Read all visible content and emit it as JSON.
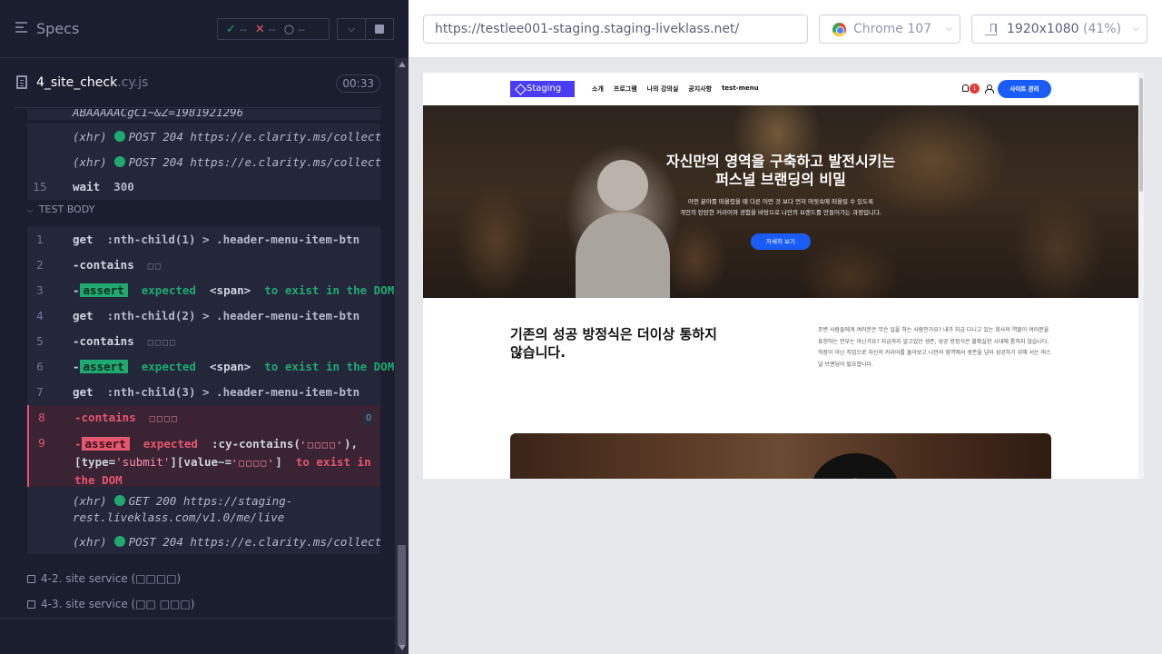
{
  "reporter": {
    "specs_label": "Specs",
    "stats": {
      "passed": "--",
      "failed": "--",
      "pending": "--"
    },
    "spec_file": {
      "name": "4_site_check",
      "ext": ".cy.js",
      "duration": "00:33"
    },
    "truncated_line": "ABAAAAACgC1~&Z=1981921296",
    "before_cmds": [
      {
        "num": "",
        "type": "(xhr)",
        "text": "POST 204 https://e.clarity.ms/collect"
      },
      {
        "num": "",
        "type": "(xhr)",
        "text": "POST 204 https://e.clarity.ms/collect"
      },
      {
        "num": "15",
        "name": "wait",
        "arg": "300"
      }
    ],
    "section_label": "TEST BODY",
    "commands": [
      {
        "num": "1",
        "name": "get",
        "arg": ":nth-child(1) > .header-menu-item-btn"
      },
      {
        "num": "2",
        "name": "-contains",
        "arg": "□□"
      },
      {
        "num": "3",
        "name": "-",
        "badge": "assert",
        "pre": "expected",
        "tag": "<span>",
        "post": "to exist in the DOM"
      },
      {
        "num": "4",
        "name": "get",
        "arg": ":nth-child(2) > .header-menu-item-btn"
      },
      {
        "num": "5",
        "name": "-contains",
        "arg": "□□□□"
      },
      {
        "num": "6",
        "name": "-",
        "badge": "assert",
        "pre": "expected",
        "tag": "<span>",
        "post": "to exist in the DOM"
      },
      {
        "num": "7",
        "name": "get",
        "arg": ":nth-child(3) > .header-menu-item-btn"
      },
      {
        "num": "8",
        "name": "-contains",
        "arg": "□□□□",
        "count": "0"
      },
      {
        "num": "9",
        "name": "-",
        "badge": "assert",
        "pre": "expected",
        "sel_open": ":cy-contains(",
        "q1": "'□□□□'",
        "sel_close": "),",
        "line2a": "[type=",
        "q2": "'submit'",
        "line2b": "][value~=",
        "q3": "'□□□□'",
        "line2c": "]",
        "post": "to exist in",
        "post2": "the DOM"
      }
    ],
    "after_cmds": [
      {
        "type": "(xhr)",
        "text": "GET 200 https://staging-",
        "text2": "rest.liveklass.com/v1.0/me/live"
      },
      {
        "type": "(xhr)",
        "text": "POST 204 https://e.clarity.ms/collect"
      }
    ],
    "suites": [
      {
        "label": "4-2. site service (□□□□)"
      },
      {
        "label": "4-3. site service (□□ □□□)"
      }
    ]
  },
  "aut": {
    "url": "https://testlee001-staging.staging-liveklass.net/",
    "browser": "Chrome 107",
    "viewport": "1920x1080",
    "scale": "(41%)",
    "site": {
      "logo": "Staging",
      "nav": [
        "소개",
        "프로그램",
        "나의 강의실",
        "공지사항",
        "test-menu"
      ],
      "notif_count": "1",
      "admin_button": "사이트 관리",
      "hero_title_1": "자신만의 영역을 구축하고 발전시키는",
      "hero_title_2": "퍼스널 브랜딩의 비밀",
      "hero_sub_1": "어떤 분야를 떠올렸을 때 다른 어떤 것 보다 먼저 머릿속에 떠올릴 수 있도록",
      "hero_sub_2": "개인의 탄탄한 커리어와 경험을 바탕으로 나만의 브랜드를 만들어가는 과정입니다.",
      "hero_button": "자세히 보기",
      "section_title_1": "기존의 성공 방정식은 더이상 통하지",
      "section_title_2": "않습니다.",
      "section_desc": "주변 사람들에게 여러분은 무슨 일을 하는 사람인가요? 내가 지금 다니고 있는 회사의 역할이 여러분을 표현하는 전부는 아닌가요? 지금까지 알고있던 생존, 성공 방정식은 불확실한 시대에 통하지 않습니다. 직장이 아닌 직업으로 자신의 커리어를 돌아보고 나만의 영역에서 생존을 넘어 성공하기 위해 서는 퍼스널 브랜딩이 필요합니다."
    }
  },
  "colors": {
    "accent_green": "#1fa971",
    "accent_red": "#e45770",
    "site_blue": "#1a5cf6"
  }
}
